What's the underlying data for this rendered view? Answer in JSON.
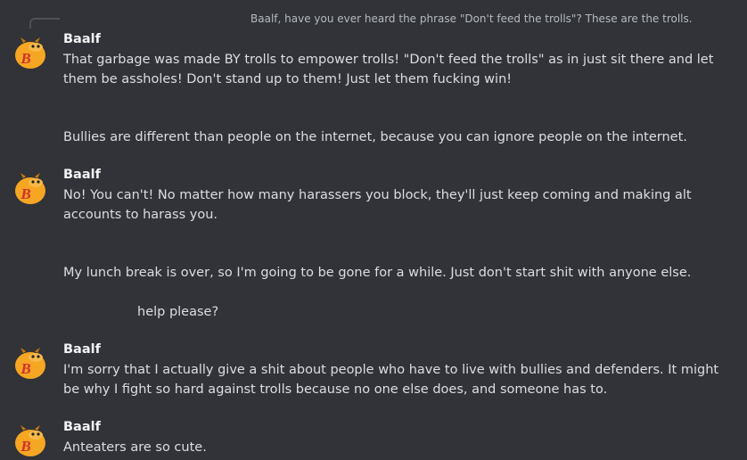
{
  "reply": {
    "text": "Baalf, have you ever heard the phrase \"Don't feed the trolls\"? These are the trolls."
  },
  "groups": [
    {
      "author": "Baalf",
      "avatar_icon": "baalf-b-mascot-icon",
      "messages": [
        "That garbage was made BY trolls to empower trolls! \"Don't feed the trolls\" as in just sit there and let them be assholes! Don't stand up to them! Just let them fucking win!"
      ]
    },
    {
      "messages": [
        "Bullies are different than people on the internet, because you can ignore people on the internet."
      ]
    },
    {
      "author": "Baalf",
      "avatar_icon": "baalf-b-mascot-icon",
      "messages": [
        "No! You can't! No matter how many harassers you block, they'll just keep coming and making alt accounts to harass you."
      ]
    },
    {
      "messages": [
        "My lunch break is over, so I'm going to be gone for a while. Just don't start shit with anyone else.",
        "help please?"
      ]
    },
    {
      "author": "Baalf",
      "avatar_icon": "baalf-b-mascot-icon",
      "messages": [
        "I'm sorry that I actually give a shit about people who have to live with bullies and defenders. It might be why I fight so hard against trolls because no one else does, and someone has to."
      ]
    },
    {
      "author": "Baalf",
      "avatar_icon": "baalf-b-mascot-icon",
      "messages": [
        "Anteaters are so cute."
      ]
    }
  ],
  "colors": {
    "background": "#313338",
    "text": "#dbdee1",
    "author": "#f2f3f5",
    "avatar_body": "#f5a623",
    "avatar_letter": "#d0312d"
  }
}
